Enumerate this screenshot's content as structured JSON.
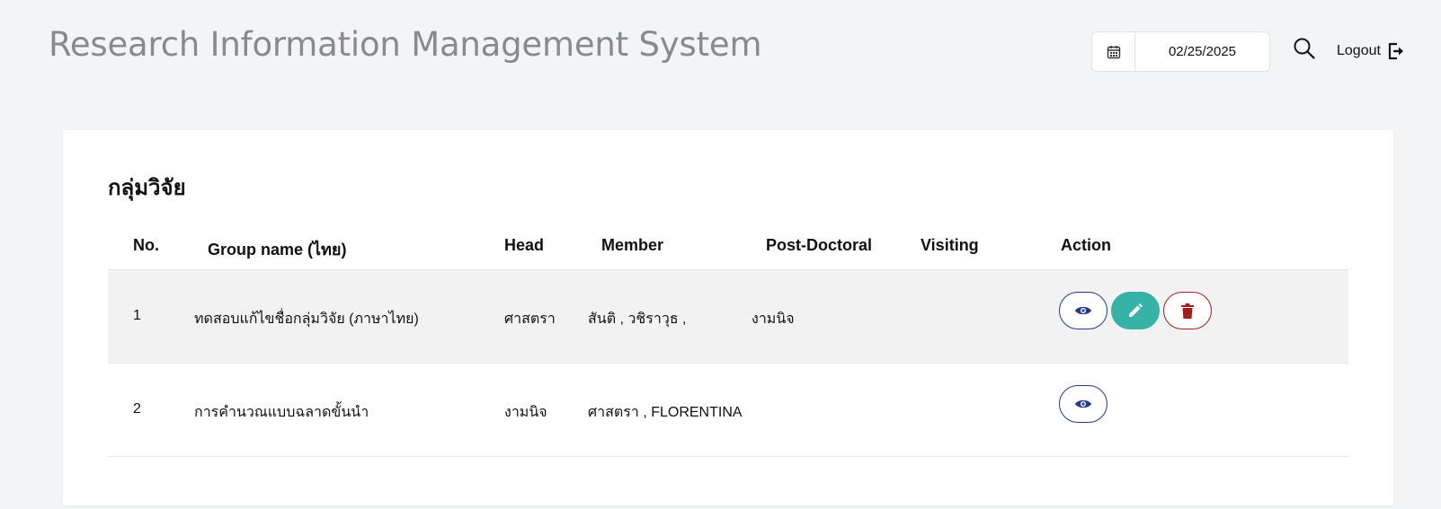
{
  "header": {
    "app_title": "Research Information Management System",
    "date": "02/25/2025",
    "logout_label": "Logout"
  },
  "section": {
    "title": "กลุ่มวิจัย"
  },
  "table": {
    "columns": {
      "no": "No.",
      "group_name": "Group name (ไทย)",
      "head": "Head",
      "member": "Member",
      "post_doctoral": "Post-Doctoral",
      "visiting": "Visiting",
      "action": "Action"
    },
    "rows": [
      {
        "no": "1",
        "group_name": "ทดสอบแก้ไขชื่อกลุ่มวิจัย (ภาษาไทย)",
        "head": "ศาสตรา",
        "member": "สันติ , วชิราวุธ ,",
        "post_doctoral": "งามนิจ",
        "visiting": "",
        "actions": [
          "view",
          "edit",
          "delete"
        ]
      },
      {
        "no": "2",
        "group_name": "การคำนวณแบบฉลาดขั้นนำ",
        "head": "งามนิจ",
        "member": "ศาสตรา , FLORENTINA",
        "post_doctoral": "",
        "visiting": "",
        "actions": [
          "view"
        ]
      }
    ]
  },
  "colors": {
    "view": "#233a8a",
    "edit": "#36b2a6",
    "delete": "#a61b1b"
  },
  "icons": [
    "calendar-icon",
    "search-icon",
    "logout-icon",
    "eye-icon",
    "pencil-icon",
    "trash-icon"
  ]
}
